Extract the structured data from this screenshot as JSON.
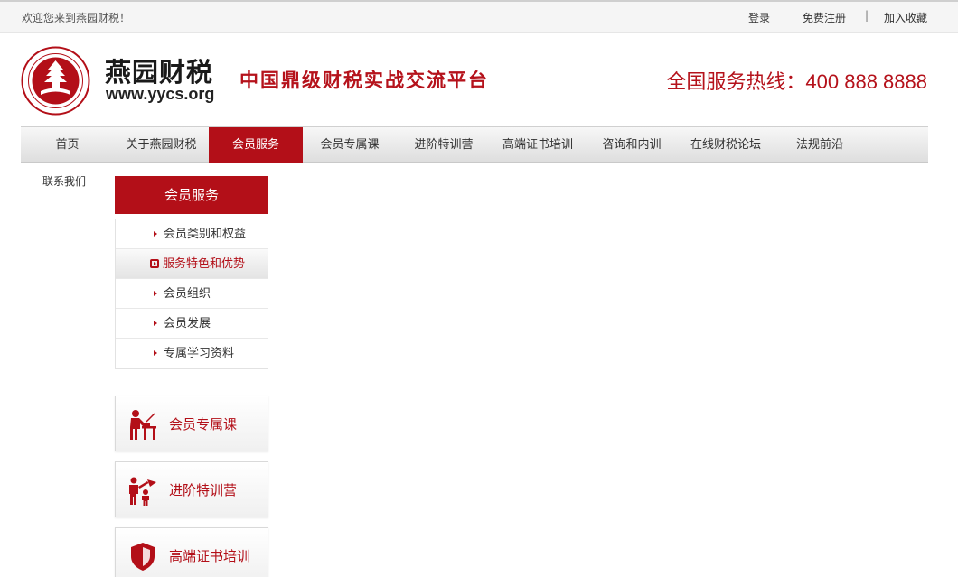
{
  "topbar": {
    "welcome": "欢迎您来到燕园财税！",
    "login": "登录",
    "register": "免费注册",
    "separator": "|",
    "favorite": "加入收藏"
  },
  "header": {
    "brand_name": "燕园财税",
    "brand_url": "www.yycs.org",
    "slogan": "中国鼎级财税实战交流平台",
    "hotline": "全国服务热线：400 888 8888"
  },
  "nav": {
    "items": [
      {
        "label": "首页"
      },
      {
        "label": "关于燕园财税"
      },
      {
        "label": "会员服务"
      },
      {
        "label": "会员专属课"
      },
      {
        "label": "进阶特训营"
      },
      {
        "label": "高端证书培训"
      },
      {
        "label": "咨询和内训"
      },
      {
        "label": "在线财税论坛"
      },
      {
        "label": "法规前沿"
      }
    ],
    "contact": "联系我们",
    "active_color": "#b30f18"
  },
  "sidebar": {
    "title": "会员服务",
    "items": [
      {
        "label": "会员类别和权益"
      },
      {
        "label": "服务特色和优势"
      },
      {
        "label": "会员组织"
      },
      {
        "label": "会员发展"
      },
      {
        "label": "专属学习资料"
      }
    ],
    "features": [
      {
        "label": "会员专属课",
        "icon": "lecturer-icon"
      },
      {
        "label": "进阶特训营",
        "icon": "trainer-icon"
      },
      {
        "label": "高端证书培训",
        "icon": "shield-icon"
      }
    ]
  },
  "colors": {
    "brand_red": "#b30f18"
  }
}
